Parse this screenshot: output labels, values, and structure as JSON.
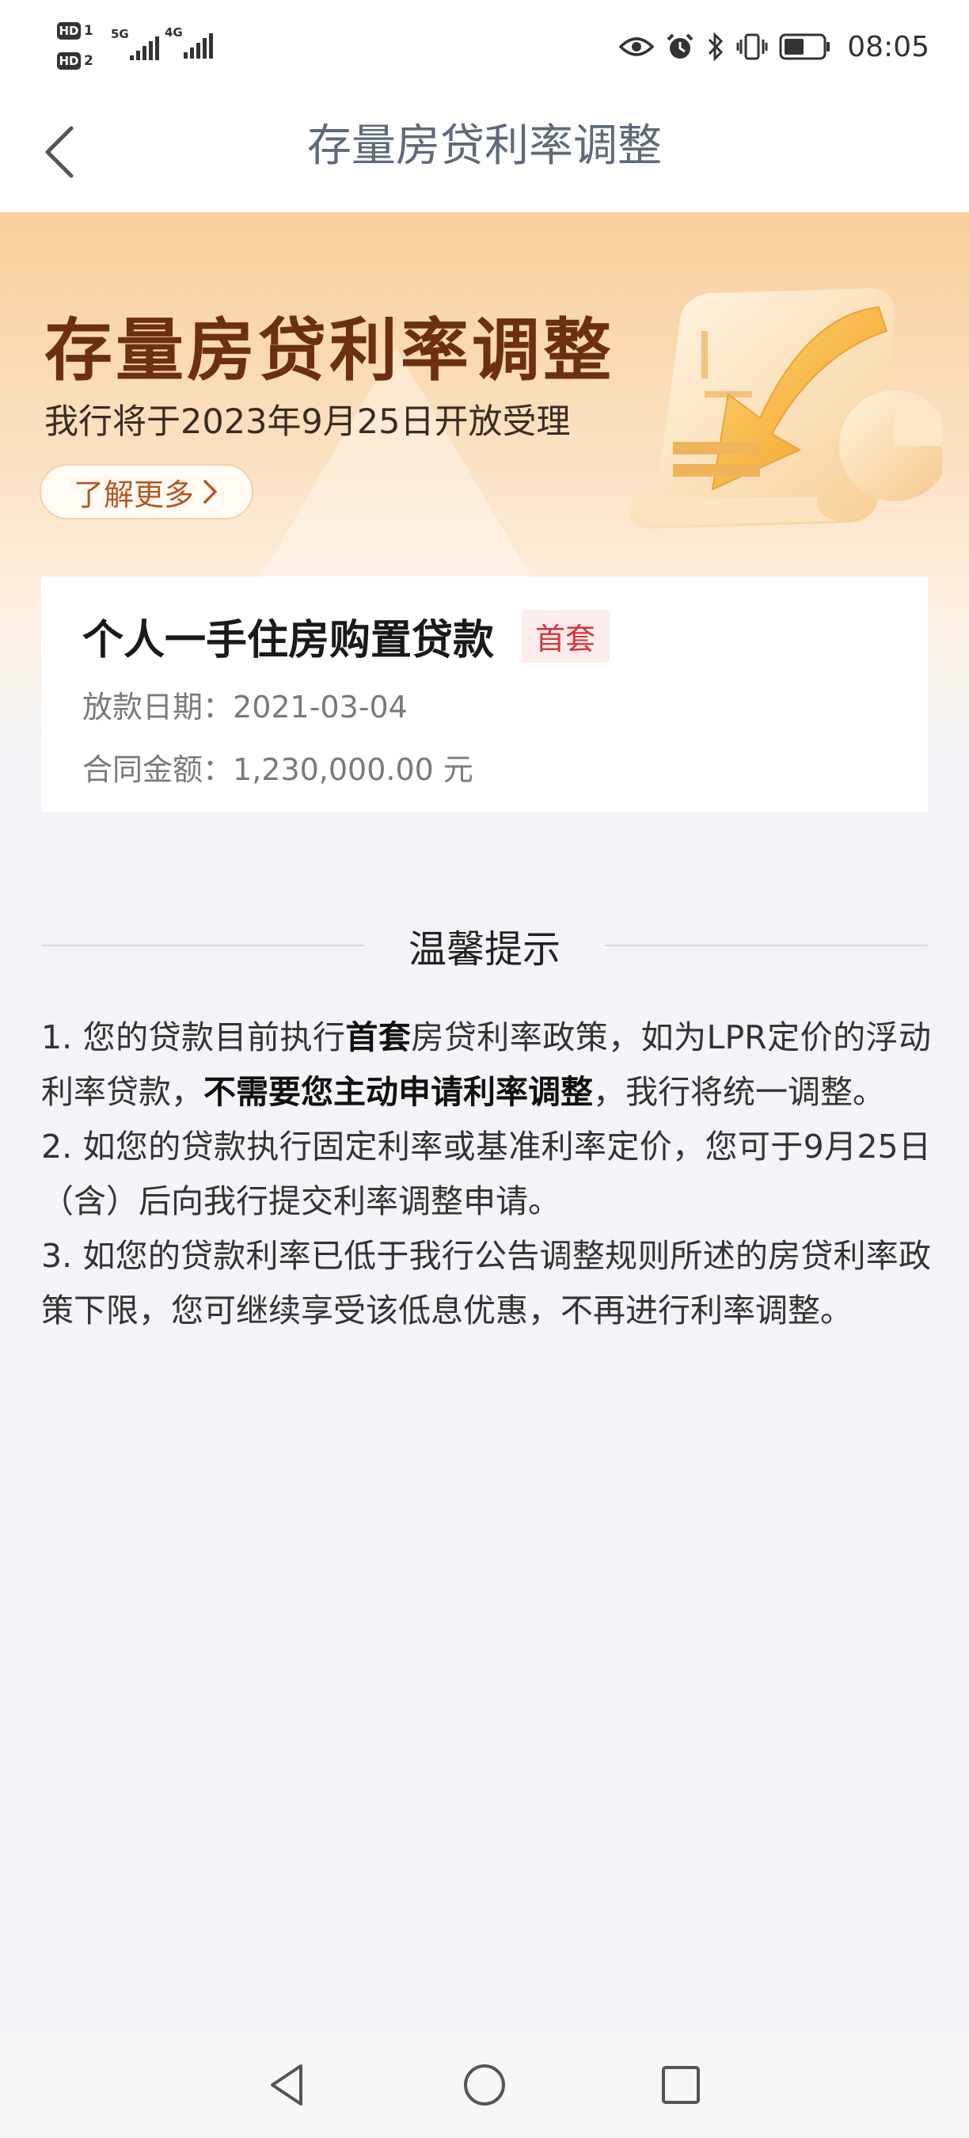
{
  "status_bar": {
    "sim1": "HD",
    "sim1_index": "1",
    "sim2": "HD",
    "sim2_index": "2",
    "network1": "5G",
    "network2": "4G",
    "time": "08:05",
    "icons": [
      "eye-icon",
      "alarm-icon",
      "bluetooth-icon",
      "vibrate-icon",
      "battery-icon"
    ]
  },
  "nav": {
    "title": "存量房贷利率调整",
    "back_icon": "chevron-left-icon"
  },
  "banner": {
    "title": "存量房贷利率调整",
    "subtitle": "我行将于2023年9月25日开放受理",
    "learn_more": "了解更多"
  },
  "loan_card": {
    "name": "个人一手住房购置贷款",
    "tag": "首套",
    "date_label": "放款日期：",
    "date_value": "2021-03-04",
    "amount_label": "合同金额：",
    "amount_value": "1,230,000.00 元",
    "tag_color": "#d2373d"
  },
  "tips": {
    "title": "温馨提示",
    "items": [
      {
        "p1": "1. 您的贷款目前执行",
        "b1": "首套",
        "p2": "房贷利率政策，如为LPR定价的浮动利率贷款，",
        "b2": "不需要您主动申请利率调整",
        "p3": "，我行将统一调整。"
      },
      {
        "text": "2. 如您的贷款执行固定利率或基准利率定价，您可于9月25日（含）后向我行提交利率调整申请。"
      },
      {
        "text": "3. 如您的贷款利率已低于我行公告调整规则所述的房贷利率政策下限，您可继续享受该低息优惠，不再进行利率调整。"
      }
    ]
  },
  "system_nav": {
    "buttons": [
      "back-triangle-icon",
      "home-circle-icon",
      "recents-square-icon"
    ]
  }
}
